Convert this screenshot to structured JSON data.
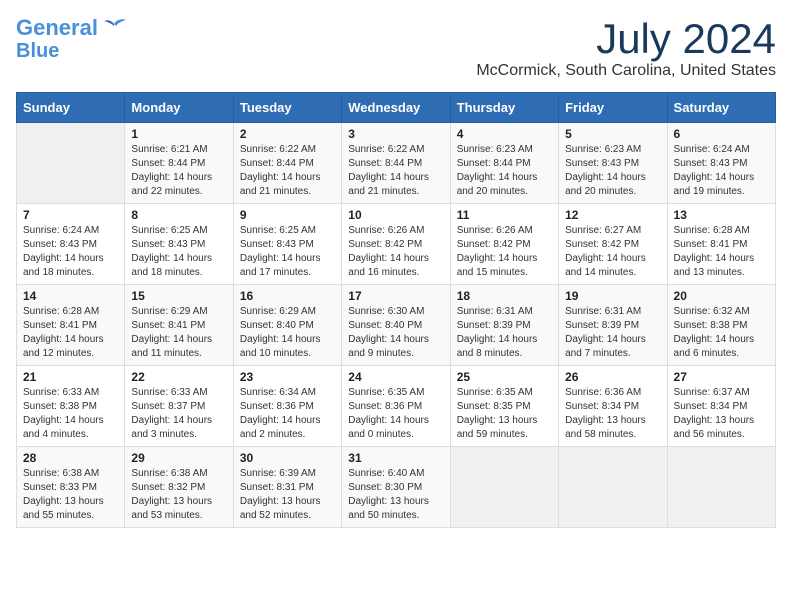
{
  "header": {
    "logo_line1": "General",
    "logo_line2": "Blue",
    "month_year": "July 2024",
    "location": "McCormick, South Carolina, United States"
  },
  "weekdays": [
    "Sunday",
    "Monday",
    "Tuesday",
    "Wednesday",
    "Thursday",
    "Friday",
    "Saturday"
  ],
  "weeks": [
    [
      {
        "day": "",
        "sunrise": "",
        "sunset": "",
        "daylight": ""
      },
      {
        "day": "1",
        "sunrise": "Sunrise: 6:21 AM",
        "sunset": "Sunset: 8:44 PM",
        "daylight": "Daylight: 14 hours and 22 minutes."
      },
      {
        "day": "2",
        "sunrise": "Sunrise: 6:22 AM",
        "sunset": "Sunset: 8:44 PM",
        "daylight": "Daylight: 14 hours and 21 minutes."
      },
      {
        "day": "3",
        "sunrise": "Sunrise: 6:22 AM",
        "sunset": "Sunset: 8:44 PM",
        "daylight": "Daylight: 14 hours and 21 minutes."
      },
      {
        "day": "4",
        "sunrise": "Sunrise: 6:23 AM",
        "sunset": "Sunset: 8:44 PM",
        "daylight": "Daylight: 14 hours and 20 minutes."
      },
      {
        "day": "5",
        "sunrise": "Sunrise: 6:23 AM",
        "sunset": "Sunset: 8:43 PM",
        "daylight": "Daylight: 14 hours and 20 minutes."
      },
      {
        "day": "6",
        "sunrise": "Sunrise: 6:24 AM",
        "sunset": "Sunset: 8:43 PM",
        "daylight": "Daylight: 14 hours and 19 minutes."
      }
    ],
    [
      {
        "day": "7",
        "sunrise": "Sunrise: 6:24 AM",
        "sunset": "Sunset: 8:43 PM",
        "daylight": "Daylight: 14 hours and 18 minutes."
      },
      {
        "day": "8",
        "sunrise": "Sunrise: 6:25 AM",
        "sunset": "Sunset: 8:43 PM",
        "daylight": "Daylight: 14 hours and 18 minutes."
      },
      {
        "day": "9",
        "sunrise": "Sunrise: 6:25 AM",
        "sunset": "Sunset: 8:43 PM",
        "daylight": "Daylight: 14 hours and 17 minutes."
      },
      {
        "day": "10",
        "sunrise": "Sunrise: 6:26 AM",
        "sunset": "Sunset: 8:42 PM",
        "daylight": "Daylight: 14 hours and 16 minutes."
      },
      {
        "day": "11",
        "sunrise": "Sunrise: 6:26 AM",
        "sunset": "Sunset: 8:42 PM",
        "daylight": "Daylight: 14 hours and 15 minutes."
      },
      {
        "day": "12",
        "sunrise": "Sunrise: 6:27 AM",
        "sunset": "Sunset: 8:42 PM",
        "daylight": "Daylight: 14 hours and 14 minutes."
      },
      {
        "day": "13",
        "sunrise": "Sunrise: 6:28 AM",
        "sunset": "Sunset: 8:41 PM",
        "daylight": "Daylight: 14 hours and 13 minutes."
      }
    ],
    [
      {
        "day": "14",
        "sunrise": "Sunrise: 6:28 AM",
        "sunset": "Sunset: 8:41 PM",
        "daylight": "Daylight: 14 hours and 12 minutes."
      },
      {
        "day": "15",
        "sunrise": "Sunrise: 6:29 AM",
        "sunset": "Sunset: 8:41 PM",
        "daylight": "Daylight: 14 hours and 11 minutes."
      },
      {
        "day": "16",
        "sunrise": "Sunrise: 6:29 AM",
        "sunset": "Sunset: 8:40 PM",
        "daylight": "Daylight: 14 hours and 10 minutes."
      },
      {
        "day": "17",
        "sunrise": "Sunrise: 6:30 AM",
        "sunset": "Sunset: 8:40 PM",
        "daylight": "Daylight: 14 hours and 9 minutes."
      },
      {
        "day": "18",
        "sunrise": "Sunrise: 6:31 AM",
        "sunset": "Sunset: 8:39 PM",
        "daylight": "Daylight: 14 hours and 8 minutes."
      },
      {
        "day": "19",
        "sunrise": "Sunrise: 6:31 AM",
        "sunset": "Sunset: 8:39 PM",
        "daylight": "Daylight: 14 hours and 7 minutes."
      },
      {
        "day": "20",
        "sunrise": "Sunrise: 6:32 AM",
        "sunset": "Sunset: 8:38 PM",
        "daylight": "Daylight: 14 hours and 6 minutes."
      }
    ],
    [
      {
        "day": "21",
        "sunrise": "Sunrise: 6:33 AM",
        "sunset": "Sunset: 8:38 PM",
        "daylight": "Daylight: 14 hours and 4 minutes."
      },
      {
        "day": "22",
        "sunrise": "Sunrise: 6:33 AM",
        "sunset": "Sunset: 8:37 PM",
        "daylight": "Daylight: 14 hours and 3 minutes."
      },
      {
        "day": "23",
        "sunrise": "Sunrise: 6:34 AM",
        "sunset": "Sunset: 8:36 PM",
        "daylight": "Daylight: 14 hours and 2 minutes."
      },
      {
        "day": "24",
        "sunrise": "Sunrise: 6:35 AM",
        "sunset": "Sunset: 8:36 PM",
        "daylight": "Daylight: 14 hours and 0 minutes."
      },
      {
        "day": "25",
        "sunrise": "Sunrise: 6:35 AM",
        "sunset": "Sunset: 8:35 PM",
        "daylight": "Daylight: 13 hours and 59 minutes."
      },
      {
        "day": "26",
        "sunrise": "Sunrise: 6:36 AM",
        "sunset": "Sunset: 8:34 PM",
        "daylight": "Daylight: 13 hours and 58 minutes."
      },
      {
        "day": "27",
        "sunrise": "Sunrise: 6:37 AM",
        "sunset": "Sunset: 8:34 PM",
        "daylight": "Daylight: 13 hours and 56 minutes."
      }
    ],
    [
      {
        "day": "28",
        "sunrise": "Sunrise: 6:38 AM",
        "sunset": "Sunset: 8:33 PM",
        "daylight": "Daylight: 13 hours and 55 minutes."
      },
      {
        "day": "29",
        "sunrise": "Sunrise: 6:38 AM",
        "sunset": "Sunset: 8:32 PM",
        "daylight": "Daylight: 13 hours and 53 minutes."
      },
      {
        "day": "30",
        "sunrise": "Sunrise: 6:39 AM",
        "sunset": "Sunset: 8:31 PM",
        "daylight": "Daylight: 13 hours and 52 minutes."
      },
      {
        "day": "31",
        "sunrise": "Sunrise: 6:40 AM",
        "sunset": "Sunset: 8:30 PM",
        "daylight": "Daylight: 13 hours and 50 minutes."
      },
      {
        "day": "",
        "sunrise": "",
        "sunset": "",
        "daylight": ""
      },
      {
        "day": "",
        "sunrise": "",
        "sunset": "",
        "daylight": ""
      },
      {
        "day": "",
        "sunrise": "",
        "sunset": "",
        "daylight": ""
      }
    ]
  ]
}
